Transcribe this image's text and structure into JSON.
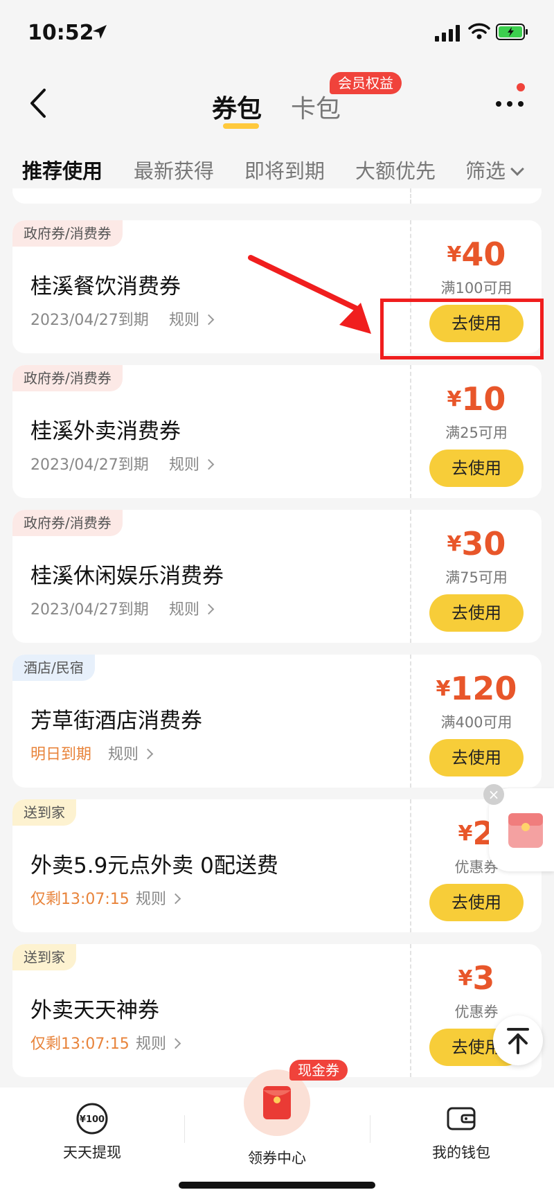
{
  "status": {
    "time": "10:52"
  },
  "header": {
    "tab_coupons": "券包",
    "tab_cards": "卡包",
    "member_badge": "会员权益"
  },
  "filters": [
    "推荐使用",
    "最新获得",
    "即将到期",
    "大额优先",
    "筛选"
  ],
  "coupons": [
    {
      "tag": "政府券/消费券",
      "title": "桂溪餐饮消费券",
      "expiry": "2023/04/27到期",
      "rule": "规则",
      "currency": "¥",
      "amount": "40",
      "condition": "满100可用",
      "button": "去使用"
    },
    {
      "tag": "政府券/消费券",
      "title": "桂溪外卖消费券",
      "expiry": "2023/04/27到期",
      "rule": "规则",
      "currency": "¥",
      "amount": "10",
      "condition": "满25可用",
      "button": "去使用"
    },
    {
      "tag": "政府券/消费券",
      "title": "桂溪休闲娱乐消费券",
      "expiry": "2023/04/27到期",
      "rule": "规则",
      "currency": "¥",
      "amount": "30",
      "condition": "满75可用",
      "button": "去使用"
    },
    {
      "tag": "酒店/民宿",
      "title": "芳草街酒店消费券",
      "expiry": "明日到期",
      "rule": "规则",
      "currency": "¥",
      "amount": "120",
      "condition": "满400可用",
      "button": "去使用"
    },
    {
      "tag": "送到家",
      "title": "外卖5.9元点外卖 0配送费",
      "expiry": "仅剩13:07:15",
      "rule": "规则",
      "currency": "¥",
      "amount": "2",
      "condition": "优惠券",
      "button": "去使用"
    },
    {
      "tag": "送到家",
      "title": "外卖天天神券",
      "expiry": "仅剩13:07:15",
      "rule": "规则",
      "currency": "¥",
      "amount": "3",
      "condition": "优惠券",
      "button": "去使用"
    }
  ],
  "bottom_nav": {
    "left": "天天提现",
    "left_icon_text": "¥100",
    "center": "领券中心",
    "center_badge": "现金券",
    "right": "我的钱包"
  },
  "colors": {
    "accent_yellow": "#f7cd39",
    "price_orange": "#e8562a",
    "badge_red": "#f0433b",
    "annotation_red": "#f01e1e"
  }
}
